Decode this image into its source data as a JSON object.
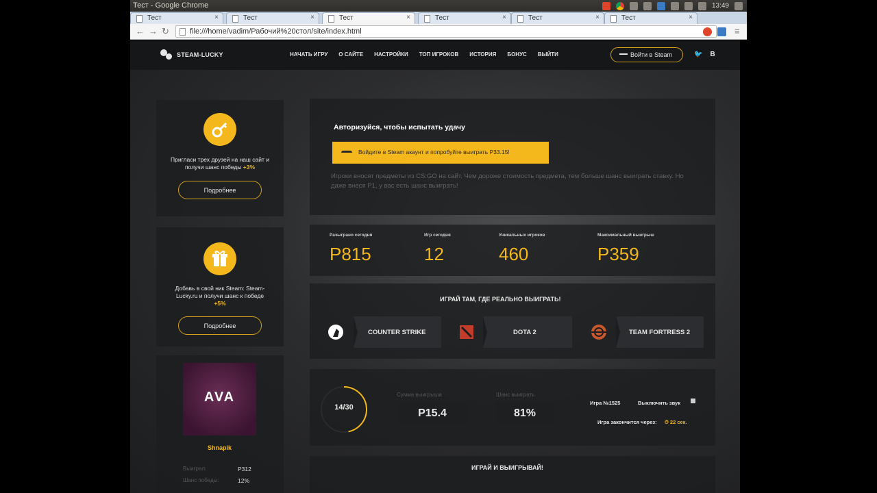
{
  "os": {
    "window_title": "Тест - Google Chrome",
    "clock": "13:49"
  },
  "browser": {
    "tabs": [
      {
        "label": "Тест",
        "active": false
      },
      {
        "label": "Тест",
        "active": false
      },
      {
        "label": "Тест",
        "active": true
      },
      {
        "label": "Тест",
        "active": false
      },
      {
        "label": "Тест",
        "active": false
      },
      {
        "label": "Тест",
        "active": false
      }
    ],
    "url": "file:///home/vadim/Рабочий%20стол/site/index.html"
  },
  "site": {
    "logo": "STEAM-LUCKY",
    "menu": [
      "НАЧАТЬ ИГРУ",
      "О САЙТЕ",
      "НАСТРОЙКИ",
      "ТОП ИГРОКОВ",
      "ИСТОРИЯ",
      "БОНУС",
      "ВЫЙТИ"
    ],
    "login_label": "Войти в Steam",
    "social": [
      "twitter-icon",
      "vk-icon"
    ],
    "social_glyphs": [
      "🐦",
      "В"
    ]
  },
  "sidebar": {
    "promo1": {
      "icon": "key-icon",
      "text": "Пригласи трех друзей на наш сайт и получи шанс победы",
      "bonus": "+3%",
      "button": "Подробнее"
    },
    "promo2": {
      "icon": "gift-icon",
      "text": "Добавь в свой ник Steam: Steam-Lucky.ru и получи шанс к победе",
      "bonus": "+5%",
      "button": "Подробнее"
    },
    "user": {
      "avatar_text": "AVA",
      "name": "Shnapik",
      "won_label": "Выиграл:",
      "won_value": "Р312",
      "chance_label": "Шанс победы:",
      "chance_value": "12%"
    }
  },
  "auth": {
    "title": "Авторизуйся, чтобы испытать удачу",
    "button": "Войдите в Steam акаунт и попробуйте выиграть Р33.15!",
    "description": "Игроки вносят предметы из CS:GO на сайт. Чем дороже стоимость предмета, тем больше шанс выиграть ставку. Но даже внеся Р1, у вас есть шанс выиграть!"
  },
  "stats": [
    {
      "label": "Разыграно сегодня",
      "value": "Р815"
    },
    {
      "label": "Игр сегодня",
      "value": "12"
    },
    {
      "label": "Уникальных игроков",
      "value": "460"
    },
    {
      "label": "Максимальный выигрыш",
      "value": "Р359"
    }
  ],
  "games": {
    "title": "ИГРАЙ ТАМ, ГДЕ РЕАЛЬНО ВЫИГРАТЬ!",
    "items": [
      {
        "name": "COUNTER STRIKE",
        "icon": "counter-strike-icon"
      },
      {
        "name": "DOTA 2",
        "icon": "dota2-icon"
      },
      {
        "name": "TEAM FORTRESS 2",
        "icon": "team-fortress-icon"
      }
    ]
  },
  "game_round": {
    "progress_text": "14/30",
    "progress": 0.467,
    "bank_label": "Сумма выигрыша",
    "bank_value": "Р15.4",
    "chance_label": "Шанс выиграть",
    "chance_value": "81%",
    "game_number": "Игра №1525",
    "sound_label": "Выключить звук",
    "ends_label": "Игра закончится через:",
    "ends_value": "⏱ 22 сек."
  },
  "play": {
    "title": "ИГРАЙ И ВЫИГРЫВАЙ!"
  },
  "colors": {
    "accent": "#f4b81c",
    "nav_bg": "#161719"
  }
}
